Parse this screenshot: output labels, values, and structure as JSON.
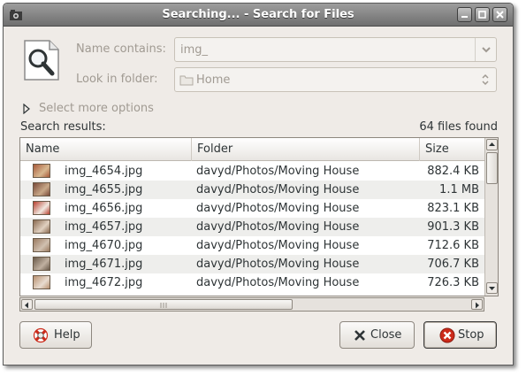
{
  "window": {
    "title": "Searching... - Search for Files"
  },
  "form": {
    "name_contains_label": "Name contains:",
    "name_contains_value": "img_",
    "look_in_label": "Look in folder:",
    "look_in_value": "Home",
    "more_options_label": "Select more options"
  },
  "results": {
    "label": "Search results:",
    "count": "64 files found",
    "columns": [
      "Name",
      "Folder",
      "Size"
    ],
    "rows": [
      {
        "name": "img_4654.jpg",
        "folder": "davyd/Photos/Moving House",
        "size": "882.4 KB"
      },
      {
        "name": "img_4655.jpg",
        "folder": "davyd/Photos/Moving House",
        "size": "1.1 MB"
      },
      {
        "name": "img_4656.jpg",
        "folder": "davyd/Photos/Moving House",
        "size": "823.1 KB"
      },
      {
        "name": "img_4657.jpg",
        "folder": "davyd/Photos/Moving House",
        "size": "901.3 KB"
      },
      {
        "name": "img_4670.jpg",
        "folder": "davyd/Photos/Moving House",
        "size": "712.6 KB"
      },
      {
        "name": "img_4671.jpg",
        "folder": "davyd/Photos/Moving House",
        "size": "706.7 KB"
      },
      {
        "name": "img_4672.jpg",
        "folder": "davyd/Photos/Moving House",
        "size": "726.3 KB"
      }
    ]
  },
  "buttons": {
    "help": "Help",
    "close": "Close",
    "stop": "Stop"
  },
  "icons": {
    "title": "file-search-icon",
    "search": "magnifier-document-icon",
    "folder": "folder-icon",
    "expander": "triangle-right-icon",
    "help": "lifebuoy-icon",
    "close": "x-icon",
    "stop": "stop-icon"
  },
  "colors": {
    "titlebar": "#7f7f7f",
    "window_bg": "#efebe7",
    "row_alt": "#eeeeec",
    "stop_red": "#cc2a1a"
  }
}
